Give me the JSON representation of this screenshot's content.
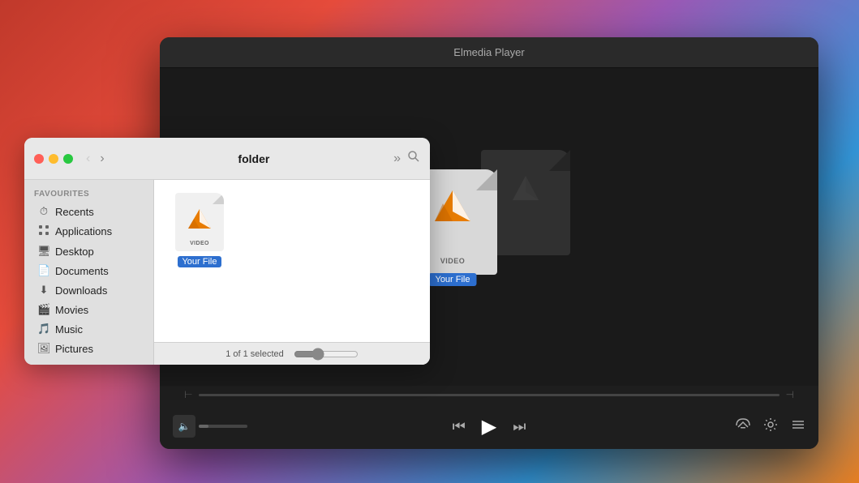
{
  "elmedia": {
    "title": "Elmedia Player",
    "file_label": "Your File",
    "file_sublabel": "VIDEO",
    "controls": {
      "prev_label": "⏮",
      "play_label": "▶",
      "next_label": "⏭",
      "airplay_label": "⊙",
      "settings_label": "⚙",
      "playlist_label": "☰"
    },
    "volume_icon": "🔈"
  },
  "finder": {
    "title": "folder",
    "status": "1 of 1 selected",
    "favourites_label": "Favourites",
    "sidebar_items": [
      {
        "icon": "clock",
        "label": "Recents"
      },
      {
        "icon": "apps",
        "label": "Applications"
      },
      {
        "icon": "desktop",
        "label": "Desktop"
      },
      {
        "icon": "docs",
        "label": "Documents"
      },
      {
        "icon": "dl",
        "label": "Downloads"
      },
      {
        "icon": "movie",
        "label": "Movies"
      },
      {
        "icon": "music",
        "label": "Music"
      },
      {
        "icon": "pics",
        "label": "Pictures"
      }
    ],
    "file": {
      "name": "Your File",
      "sublabel": "VIDEO"
    }
  }
}
